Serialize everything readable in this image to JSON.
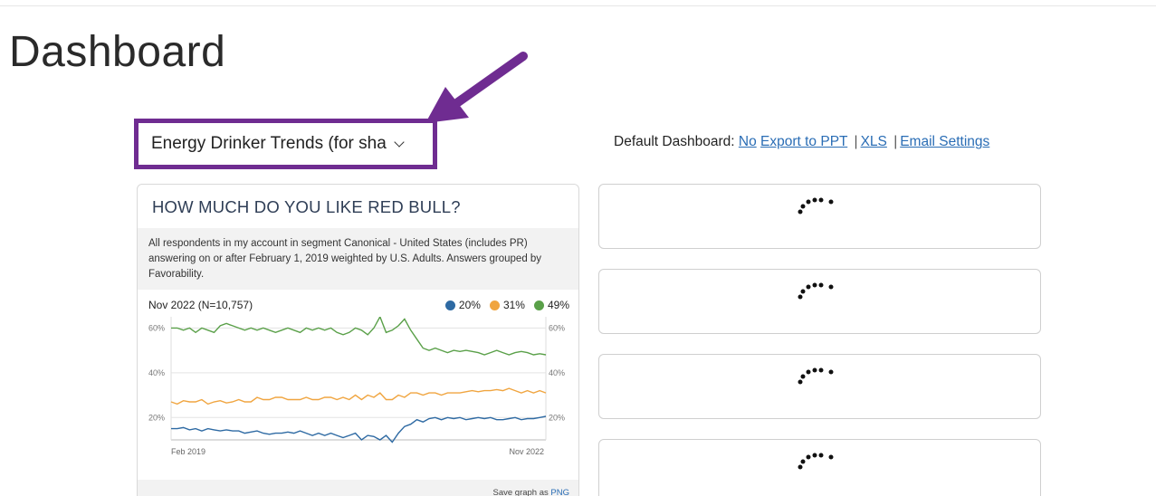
{
  "page": {
    "title": "Dashboard"
  },
  "selector": {
    "value": "Energy Drinker Trends (for sha"
  },
  "links": {
    "default_label": "Default Dashboard:",
    "default_value": "No",
    "export_ppt": "Export to PPT",
    "sep": "|",
    "xls": "XLS",
    "email": "Email Settings"
  },
  "card": {
    "title": "HOW MUCH DO YOU LIKE RED BULL?",
    "description": "All respondents in my account in segment Canonical - United States (includes PR) answering on or after February 1, 2019 weighted by U.S. Adults. Answers grouped by Favorability.",
    "period": "Nov 2022 (N=10,757)",
    "save_prefix": "Save graph as",
    "save_link": "PNG"
  },
  "colors": {
    "accent": "#6f2c91",
    "link": "#2a6db5",
    "blue": "#2e6aa3",
    "orange": "#f0a540",
    "green": "#5aa049"
  },
  "chart_data": {
    "type": "line",
    "ylim": [
      10,
      65
    ],
    "y_ticks": [
      "60%",
      "40%",
      "20%"
    ],
    "x_labels": [
      "Feb 2019",
      "Nov 2022"
    ],
    "series": [
      {
        "name": "20%",
        "color": "#2e6aa3",
        "values": [
          15,
          15,
          15.5,
          14.5,
          15,
          14,
          15,
          14.5,
          14,
          14.5,
          14,
          14,
          13,
          13.5,
          14,
          13,
          12.5,
          13,
          13,
          13.5,
          13,
          14,
          13,
          12,
          13,
          12,
          13,
          12,
          11,
          12,
          13,
          10,
          12,
          11.5,
          10,
          12,
          9,
          13,
          16,
          17,
          19,
          18,
          19.5,
          20,
          19,
          20,
          19.5,
          20,
          19,
          19.5,
          20,
          19.5,
          20,
          19,
          19,
          19.5,
          20,
          19,
          19.5,
          19.5,
          20,
          20.5
        ]
      },
      {
        "name": "31%",
        "color": "#f0a540",
        "values": [
          27,
          26,
          27.5,
          27,
          27,
          28,
          26,
          27,
          27.5,
          26.5,
          27,
          28,
          27,
          27,
          29,
          28,
          28,
          29,
          29,
          28,
          28,
          28,
          29,
          28,
          28,
          29,
          29,
          28,
          29,
          28,
          30,
          28,
          30,
          29,
          31,
          28,
          28,
          30,
          29,
          31,
          31,
          30,
          31,
          31,
          30,
          31,
          31,
          31,
          31.5,
          32,
          31.5,
          32,
          32,
          32.5,
          32,
          33,
          32,
          31,
          32,
          31,
          32,
          31
        ]
      },
      {
        "name": "49%",
        "color": "#5aa049",
        "values": [
          60,
          60,
          59,
          60,
          58,
          60,
          59,
          58,
          61,
          62,
          61,
          60,
          59,
          60,
          59,
          60,
          59,
          58,
          59,
          60,
          59,
          58,
          60,
          59,
          60,
          59,
          60,
          58,
          57,
          58,
          60,
          59,
          57,
          60,
          65,
          58,
          59,
          61,
          64,
          59,
          55,
          51,
          50,
          51,
          50,
          49,
          50,
          49.5,
          50,
          49.5,
          49,
          48,
          49,
          50,
          49,
          48,
          49,
          49.5,
          49,
          48,
          48.5,
          48
        ]
      }
    ]
  }
}
